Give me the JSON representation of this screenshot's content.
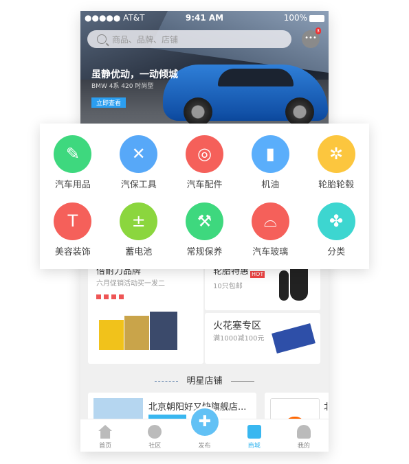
{
  "status": {
    "carrier": "●●●●● AT&T",
    "time": "9:41 AM",
    "battery": "100%"
  },
  "search": {
    "placeholder": "商品、品牌、店铺"
  },
  "messages": {
    "badge": "3"
  },
  "banner": {
    "title": "虽静优动，一动倾城",
    "subtitle": "BMW 4系 420 时尚型",
    "cta": "立即查看"
  },
  "categories": [
    {
      "label": "汽车用品",
      "color": "#3ed87e",
      "icon": "tools-icon",
      "glyph": "✎"
    },
    {
      "label": "汽保工具",
      "color": "#57a8f8",
      "icon": "wrench-screwdriver-icon",
      "glyph": "✕"
    },
    {
      "label": "汽车配件",
      "color": "#f5605a",
      "icon": "brake-disc-icon",
      "glyph": "◎"
    },
    {
      "label": "机油",
      "color": "#5aaefb",
      "icon": "oil-can-icon",
      "glyph": "▮"
    },
    {
      "label": "轮胎轮毂",
      "color": "#fcc63e",
      "icon": "wheel-icon",
      "glyph": "✲"
    },
    {
      "label": "美容装饰",
      "color": "#f5605a",
      "icon": "wiper-icon",
      "glyph": "T"
    },
    {
      "label": "蓄电池",
      "color": "#8bd63e",
      "icon": "battery-icon",
      "glyph": "±"
    },
    {
      "label": "常规保养",
      "color": "#3ed87e",
      "icon": "mechanic-icon",
      "glyph": "⚒"
    },
    {
      "label": "汽车玻璃",
      "color": "#f5605a",
      "icon": "windshield-icon",
      "glyph": "⌓"
    },
    {
      "label": "分类",
      "color": "#3dd6d0",
      "icon": "category-icon",
      "glyph": "✤"
    }
  ],
  "promos": {
    "brand": {
      "title": "倍耐力品牌",
      "subtitle": "六月促销活动买一发二"
    },
    "tires": {
      "title": "轮胎特惠",
      "hot": "HOT",
      "subtitle": "10只包邮"
    },
    "spark": {
      "title": "火花塞专区",
      "subtitle": "满1000减100元"
    }
  },
  "section": {
    "title": "明星店铺"
  },
  "stores": [
    {
      "name": "北京朝阳好又快旗舰店..."
    },
    {
      "name": "北"
    }
  ],
  "tabs": [
    {
      "label": "首页",
      "icon": "home-icon"
    },
    {
      "label": "社区",
      "icon": "community-icon"
    },
    {
      "label": "发布",
      "icon": "publish-icon"
    },
    {
      "label": "商城",
      "icon": "store-icon",
      "active": true
    },
    {
      "label": "我的",
      "icon": "profile-icon"
    }
  ],
  "accent": "#39b7f0"
}
